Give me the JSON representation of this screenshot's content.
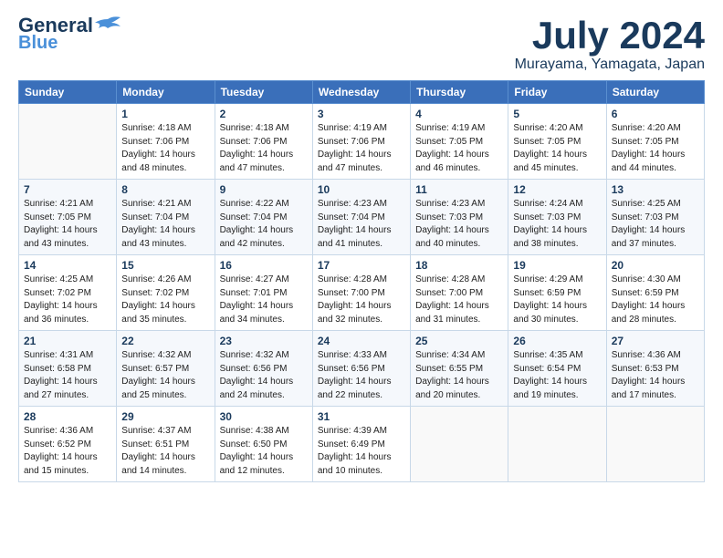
{
  "header": {
    "logo_line1": "General",
    "logo_line2": "Blue",
    "month": "July 2024",
    "location": "Murayama, Yamagata, Japan"
  },
  "weekdays": [
    "Sunday",
    "Monday",
    "Tuesday",
    "Wednesday",
    "Thursday",
    "Friday",
    "Saturday"
  ],
  "weeks": [
    [
      {
        "day": "",
        "sunrise": "",
        "sunset": "",
        "daylight": ""
      },
      {
        "day": "1",
        "sunrise": "Sunrise: 4:18 AM",
        "sunset": "Sunset: 7:06 PM",
        "daylight": "Daylight: 14 hours and 48 minutes."
      },
      {
        "day": "2",
        "sunrise": "Sunrise: 4:18 AM",
        "sunset": "Sunset: 7:06 PM",
        "daylight": "Daylight: 14 hours and 47 minutes."
      },
      {
        "day": "3",
        "sunrise": "Sunrise: 4:19 AM",
        "sunset": "Sunset: 7:06 PM",
        "daylight": "Daylight: 14 hours and 47 minutes."
      },
      {
        "day": "4",
        "sunrise": "Sunrise: 4:19 AM",
        "sunset": "Sunset: 7:05 PM",
        "daylight": "Daylight: 14 hours and 46 minutes."
      },
      {
        "day": "5",
        "sunrise": "Sunrise: 4:20 AM",
        "sunset": "Sunset: 7:05 PM",
        "daylight": "Daylight: 14 hours and 45 minutes."
      },
      {
        "day": "6",
        "sunrise": "Sunrise: 4:20 AM",
        "sunset": "Sunset: 7:05 PM",
        "daylight": "Daylight: 14 hours and 44 minutes."
      }
    ],
    [
      {
        "day": "7",
        "sunrise": "Sunrise: 4:21 AM",
        "sunset": "Sunset: 7:05 PM",
        "daylight": "Daylight: 14 hours and 43 minutes."
      },
      {
        "day": "8",
        "sunrise": "Sunrise: 4:21 AM",
        "sunset": "Sunset: 7:04 PM",
        "daylight": "Daylight: 14 hours and 43 minutes."
      },
      {
        "day": "9",
        "sunrise": "Sunrise: 4:22 AM",
        "sunset": "Sunset: 7:04 PM",
        "daylight": "Daylight: 14 hours and 42 minutes."
      },
      {
        "day": "10",
        "sunrise": "Sunrise: 4:23 AM",
        "sunset": "Sunset: 7:04 PM",
        "daylight": "Daylight: 14 hours and 41 minutes."
      },
      {
        "day": "11",
        "sunrise": "Sunrise: 4:23 AM",
        "sunset": "Sunset: 7:03 PM",
        "daylight": "Daylight: 14 hours and 40 minutes."
      },
      {
        "day": "12",
        "sunrise": "Sunrise: 4:24 AM",
        "sunset": "Sunset: 7:03 PM",
        "daylight": "Daylight: 14 hours and 38 minutes."
      },
      {
        "day": "13",
        "sunrise": "Sunrise: 4:25 AM",
        "sunset": "Sunset: 7:03 PM",
        "daylight": "Daylight: 14 hours and 37 minutes."
      }
    ],
    [
      {
        "day": "14",
        "sunrise": "Sunrise: 4:25 AM",
        "sunset": "Sunset: 7:02 PM",
        "daylight": "Daylight: 14 hours and 36 minutes."
      },
      {
        "day": "15",
        "sunrise": "Sunrise: 4:26 AM",
        "sunset": "Sunset: 7:02 PM",
        "daylight": "Daylight: 14 hours and 35 minutes."
      },
      {
        "day": "16",
        "sunrise": "Sunrise: 4:27 AM",
        "sunset": "Sunset: 7:01 PM",
        "daylight": "Daylight: 14 hours and 34 minutes."
      },
      {
        "day": "17",
        "sunrise": "Sunrise: 4:28 AM",
        "sunset": "Sunset: 7:00 PM",
        "daylight": "Daylight: 14 hours and 32 minutes."
      },
      {
        "day": "18",
        "sunrise": "Sunrise: 4:28 AM",
        "sunset": "Sunset: 7:00 PM",
        "daylight": "Daylight: 14 hours and 31 minutes."
      },
      {
        "day": "19",
        "sunrise": "Sunrise: 4:29 AM",
        "sunset": "Sunset: 6:59 PM",
        "daylight": "Daylight: 14 hours and 30 minutes."
      },
      {
        "day": "20",
        "sunrise": "Sunrise: 4:30 AM",
        "sunset": "Sunset: 6:59 PM",
        "daylight": "Daylight: 14 hours and 28 minutes."
      }
    ],
    [
      {
        "day": "21",
        "sunrise": "Sunrise: 4:31 AM",
        "sunset": "Sunset: 6:58 PM",
        "daylight": "Daylight: 14 hours and 27 minutes."
      },
      {
        "day": "22",
        "sunrise": "Sunrise: 4:32 AM",
        "sunset": "Sunset: 6:57 PM",
        "daylight": "Daylight: 14 hours and 25 minutes."
      },
      {
        "day": "23",
        "sunrise": "Sunrise: 4:32 AM",
        "sunset": "Sunset: 6:56 PM",
        "daylight": "Daylight: 14 hours and 24 minutes."
      },
      {
        "day": "24",
        "sunrise": "Sunrise: 4:33 AM",
        "sunset": "Sunset: 6:56 PM",
        "daylight": "Daylight: 14 hours and 22 minutes."
      },
      {
        "day": "25",
        "sunrise": "Sunrise: 4:34 AM",
        "sunset": "Sunset: 6:55 PM",
        "daylight": "Daylight: 14 hours and 20 minutes."
      },
      {
        "day": "26",
        "sunrise": "Sunrise: 4:35 AM",
        "sunset": "Sunset: 6:54 PM",
        "daylight": "Daylight: 14 hours and 19 minutes."
      },
      {
        "day": "27",
        "sunrise": "Sunrise: 4:36 AM",
        "sunset": "Sunset: 6:53 PM",
        "daylight": "Daylight: 14 hours and 17 minutes."
      }
    ],
    [
      {
        "day": "28",
        "sunrise": "Sunrise: 4:36 AM",
        "sunset": "Sunset: 6:52 PM",
        "daylight": "Daylight: 14 hours and 15 minutes."
      },
      {
        "day": "29",
        "sunrise": "Sunrise: 4:37 AM",
        "sunset": "Sunset: 6:51 PM",
        "daylight": "Daylight: 14 hours and 14 minutes."
      },
      {
        "day": "30",
        "sunrise": "Sunrise: 4:38 AM",
        "sunset": "Sunset: 6:50 PM",
        "daylight": "Daylight: 14 hours and 12 minutes."
      },
      {
        "day": "31",
        "sunrise": "Sunrise: 4:39 AM",
        "sunset": "Sunset: 6:49 PM",
        "daylight": "Daylight: 14 hours and 10 minutes."
      },
      {
        "day": "",
        "sunrise": "",
        "sunset": "",
        "daylight": ""
      },
      {
        "day": "",
        "sunrise": "",
        "sunset": "",
        "daylight": ""
      },
      {
        "day": "",
        "sunrise": "",
        "sunset": "",
        "daylight": ""
      }
    ]
  ]
}
